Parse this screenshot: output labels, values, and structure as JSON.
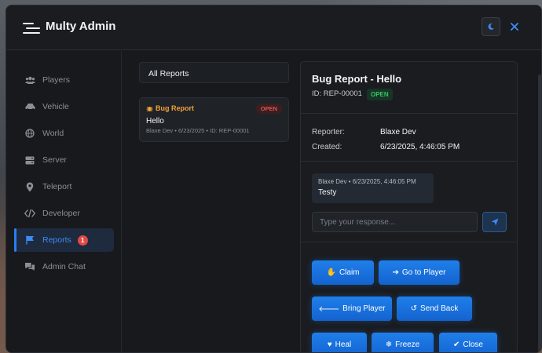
{
  "app": {
    "title": "Multy Admin"
  },
  "sidebar": {
    "items": [
      {
        "label": "Players",
        "icon": "users-icon"
      },
      {
        "label": "Vehicle",
        "icon": "car-icon"
      },
      {
        "label": "World",
        "icon": "globe-icon"
      },
      {
        "label": "Server",
        "icon": "server-icon"
      },
      {
        "label": "Teleport",
        "icon": "map-pin-icon"
      },
      {
        "label": "Developer",
        "icon": "code-icon"
      },
      {
        "label": "Reports",
        "icon": "flag-icon",
        "badge": "1",
        "active": true
      },
      {
        "label": "Admin Chat",
        "icon": "chat-icon"
      }
    ]
  },
  "reports_list": {
    "header": "All Reports",
    "items": [
      {
        "type": "Bug Report",
        "status": "OPEN",
        "title": "Hello",
        "meta": "Blaxe Dev • 6/23/2025 • ID: REP-00001"
      }
    ]
  },
  "detail": {
    "title": "Bug Report - Hello",
    "id": "ID: REP-00001",
    "status": "OPEN",
    "reporter_label": "Reporter:",
    "reporter_value": "Blaxe Dev",
    "created_label": "Created:",
    "created_value": "6/23/2025, 4:46:05 PM",
    "message": {
      "meta": "Blaxe Dev • 6/23/2025, 4:46:05 PM",
      "text": "Testy"
    },
    "response_placeholder": "Type your response...",
    "actions": {
      "claim": "Claim",
      "goto": "Go to Player",
      "bring": "Bring Player",
      "sendback": "Send Back",
      "heal": "Heal",
      "freeze": "Freeze",
      "close": "Close"
    }
  },
  "colors": {
    "accent": "#1f7fea",
    "open_red": "#e0524d",
    "open_green": "#35c46a",
    "bug_orange": "#f0a23a"
  }
}
